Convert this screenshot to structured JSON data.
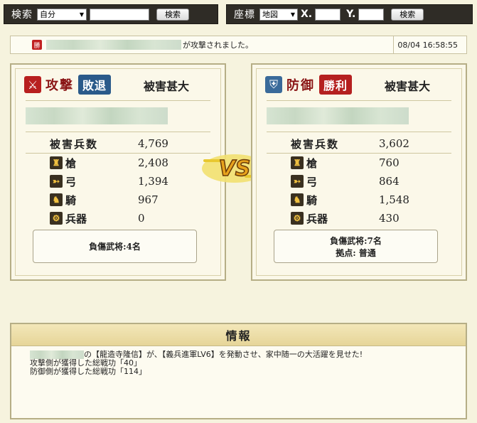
{
  "search_bar": {
    "label": "検索",
    "select_value": "自分",
    "button": "検索"
  },
  "coord_bar": {
    "label": "座標",
    "select_value": "地図",
    "x_label": "X.",
    "y_label": "Y.",
    "button": "検索"
  },
  "notice": {
    "badge": "勝",
    "message": "が攻撃されました。",
    "time": "08/04 16:58:55"
  },
  "attack": {
    "title": "攻撃",
    "result": "敗退",
    "damage_level": "被害甚大",
    "total_label": "被害兵数",
    "total": "4,769",
    "units": [
      {
        "name": "槍",
        "value": "2,408",
        "icon": "spear-icon"
      },
      {
        "name": "弓",
        "value": "1,394",
        "icon": "bow-icon"
      },
      {
        "name": "騎",
        "value": "967",
        "icon": "horse-icon"
      },
      {
        "name": "兵器",
        "value": "0",
        "icon": "siege-weapon-icon"
      }
    ],
    "wounded": "負傷武将:4名"
  },
  "defense": {
    "title": "防御",
    "result": "勝利",
    "damage_level": "被害甚大",
    "total_label": "被害兵数",
    "total": "3,602",
    "units": [
      {
        "name": "槍",
        "value": "760",
        "icon": "spear-icon"
      },
      {
        "name": "弓",
        "value": "864",
        "icon": "bow-icon"
      },
      {
        "name": "騎",
        "value": "1,548",
        "icon": "horse-icon"
      },
      {
        "name": "兵器",
        "value": "430",
        "icon": "siege-weapon-icon"
      }
    ],
    "wounded": "負傷武将:7名",
    "base": "拠点: 普通"
  },
  "vs_text": "VS",
  "info": {
    "title": "情報",
    "line1": "の【龍造寺隆信】が、【義兵進軍LV6】を発動させ、家中随一の大活躍を見せた!",
    "line2": "攻撃側が獲得した総戦功「40」",
    "line3": "防御側が獲得した総戦功「114」"
  },
  "colors": {
    "background": "#f6f3de",
    "bar": "#2f2c26",
    "lose_badge": "#2a5a8a",
    "win_badge": "#b52020"
  }
}
